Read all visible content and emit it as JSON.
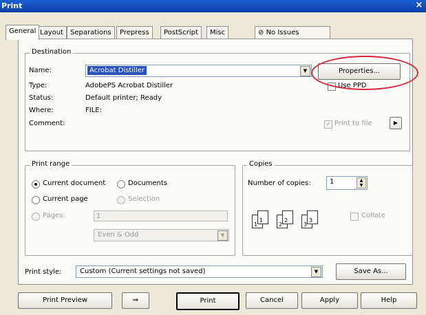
{
  "window": {
    "title": "Print",
    "close_glyph": "×"
  },
  "tabs": [
    {
      "label": "General"
    },
    {
      "label": "Layout"
    },
    {
      "label": "Separations"
    },
    {
      "label": "Prepress"
    },
    {
      "label": "PostScript"
    },
    {
      "label": "Misc"
    },
    {
      "label": "No Issues"
    }
  ],
  "destination": {
    "legend": "Destination",
    "name_label": "Name:",
    "name_value": "Acrobat Distiller",
    "properties_label": "Properties...",
    "type_label": "Type:",
    "type_value": "AdobePS Acrobat Distiller",
    "status_label": "Status:",
    "status_value": "Default printer; Ready",
    "where_label": "Where:",
    "where_value": "FILE:",
    "comment_label": "Comment:",
    "use_ppd_label": "Use PPD",
    "print_to_file_label": "Print to file",
    "print_to_file_checked_glyph": "✓",
    "arrow_glyph": "▶"
  },
  "print_range": {
    "legend": "Print range",
    "current_document": "Current document",
    "documents": "Documents",
    "current_page": "Current page",
    "selection": "Selection",
    "pages_label": "Pages:",
    "pages_value": "1",
    "even_odd_value": "Even & Odd"
  },
  "copies": {
    "legend": "Copies",
    "number_label": "Number of copies:",
    "number_value": "1",
    "collate_label": "Collate",
    "collate_pages": [
      "1",
      "1",
      "2",
      "2",
      "3",
      "3"
    ]
  },
  "print_style": {
    "label": "Print style:",
    "value": "Custom (Current settings not saved)",
    "save_as_label": "Save As..."
  },
  "footer": {
    "print_preview": "Print Preview",
    "preview_icon_glyph": "⇒",
    "print": "Print",
    "cancel": "Cancel",
    "apply": "Apply",
    "help": "Help"
  },
  "icons": {
    "dropdown_glyph": "▼",
    "spin_up": "▲",
    "spin_down": "▼",
    "no_issues_icon": "⊘"
  },
  "annotation_color": "#d9263a"
}
